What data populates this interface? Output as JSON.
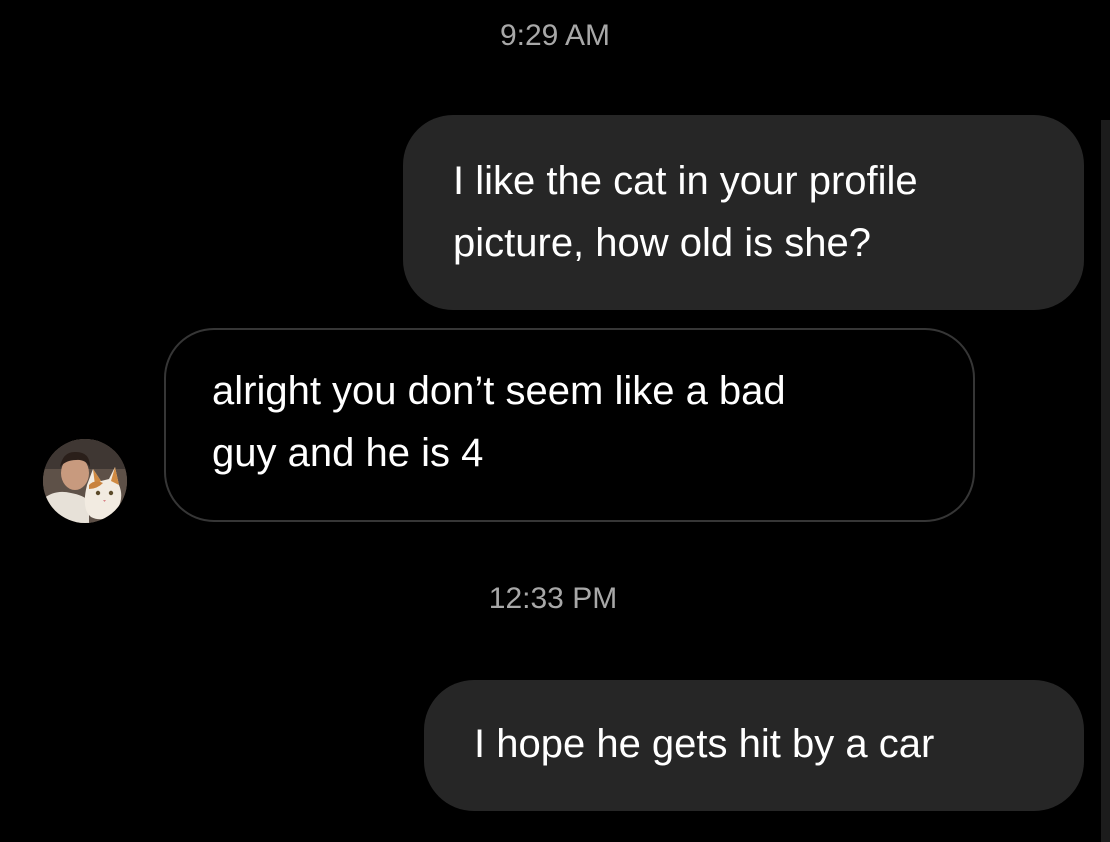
{
  "thread": {
    "timestamp_1": "9:29 AM",
    "timestamp_2": "12:33 PM",
    "messages": [
      {
        "sender": "me",
        "lines": [
          "I like the cat in your profile",
          "picture, how old is she?"
        ]
      },
      {
        "sender": "them",
        "lines": [
          "alright you don’t seem like a bad",
          "guy and he is 4"
        ]
      },
      {
        "sender": "me",
        "lines": [
          "I hope he gets hit by a car"
        ]
      }
    ]
  },
  "colors": {
    "background": "#000000",
    "sent_bubble": "#262626",
    "received_bubble_border": "#363636",
    "timestamp_text": "#a8a8a8",
    "message_text": "#ffffff"
  },
  "icons": {
    "avatar": "profile-photo-person-with-cat"
  }
}
